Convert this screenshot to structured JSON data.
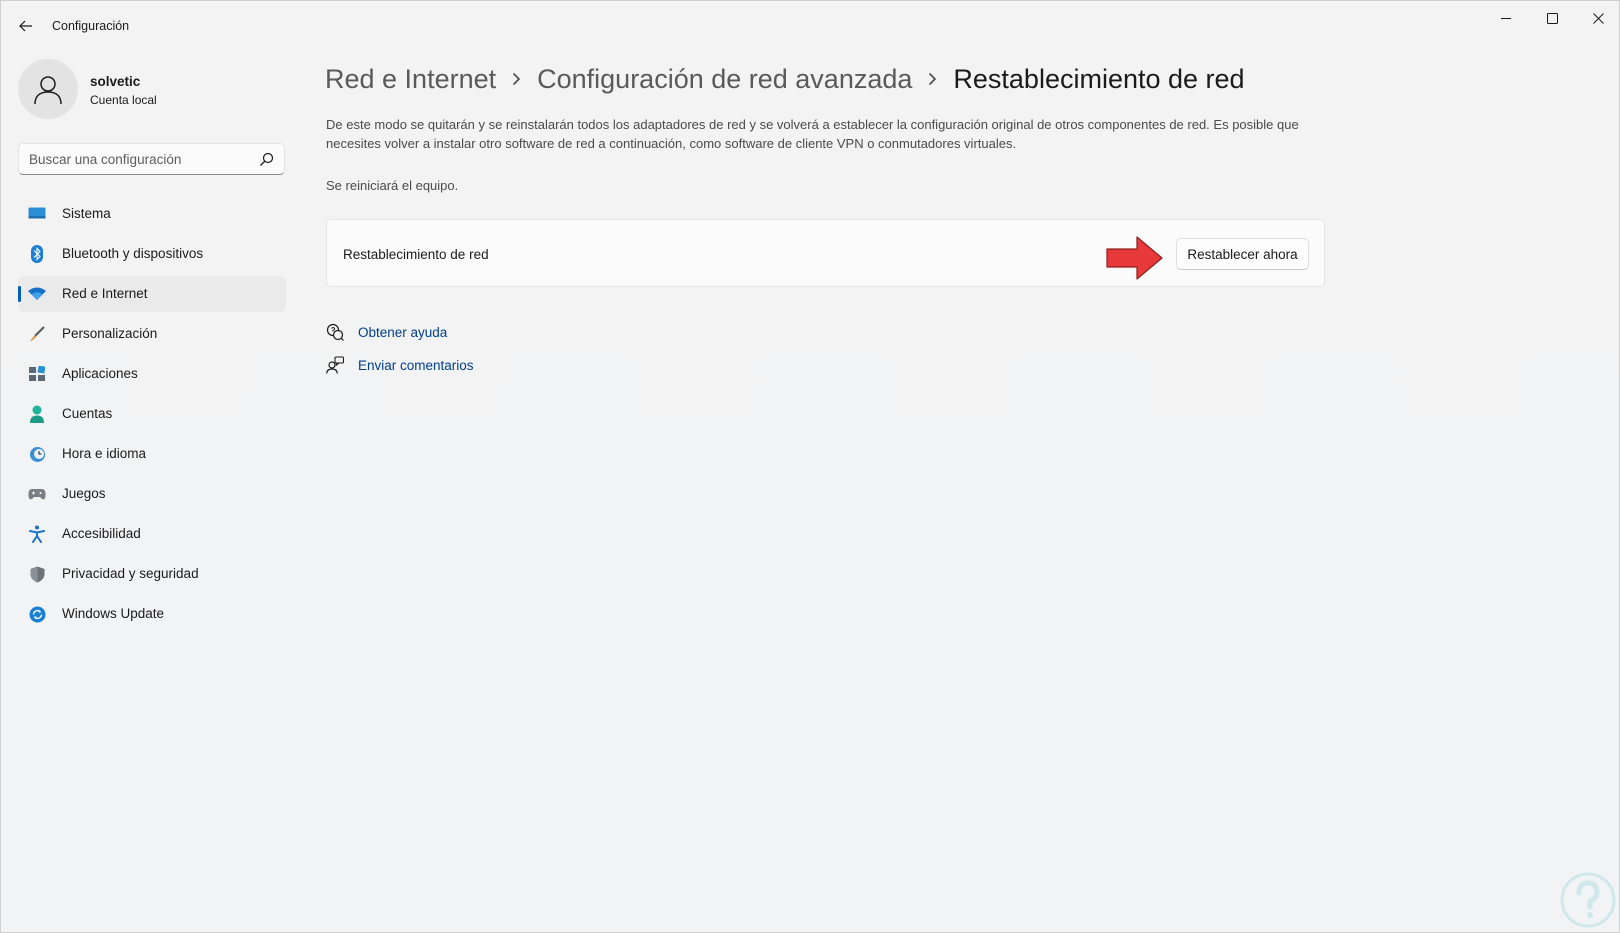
{
  "window": {
    "title": "Configuración",
    "minimize_icon": "minimize-icon",
    "maximize_icon": "maximize-icon",
    "close_icon": "close-icon"
  },
  "profile": {
    "name": "solvetic",
    "subtitle": "Cuenta local"
  },
  "search": {
    "placeholder": "Buscar una configuración"
  },
  "sidebar": {
    "items": [
      {
        "label": "Sistema",
        "icon": "monitor-icon"
      },
      {
        "label": "Bluetooth y dispositivos",
        "icon": "bluetooth-icon"
      },
      {
        "label": "Red e Internet",
        "icon": "wifi-icon",
        "active": true
      },
      {
        "label": "Personalización",
        "icon": "brush-icon"
      },
      {
        "label": "Aplicaciones",
        "icon": "apps-icon"
      },
      {
        "label": "Cuentas",
        "icon": "person-icon"
      },
      {
        "label": "Hora e idioma",
        "icon": "clock-globe-icon"
      },
      {
        "label": "Juegos",
        "icon": "gamepad-icon"
      },
      {
        "label": "Accesibilidad",
        "icon": "accessibility-icon"
      },
      {
        "label": "Privacidad y seguridad",
        "icon": "shield-icon"
      },
      {
        "label": "Windows Update",
        "icon": "update-icon"
      }
    ]
  },
  "breadcrumb": {
    "items": [
      "Red e Internet",
      "Configuración de red avanzada"
    ],
    "current": "Restablecimiento de red"
  },
  "main": {
    "description": "De este modo se quitarán y se reinstalarán todos los adaptadores de red y se volverá a establecer la configuración original de otros componentes de red. Es posible que necesites volver a instalar otro software de red a continuación, como software de cliente VPN o conmutadores virtuales.",
    "restart_note": "Se reiniciará el equipo.",
    "card_label": "Restablecimiento de red",
    "reset_button": "Restablecer ahora",
    "help_link": "Obtener ayuda",
    "feedback_link": "Enviar comentarios"
  },
  "colors": {
    "accent": "#005fb8",
    "link": "#003e92",
    "arrow": "#e8393a"
  }
}
